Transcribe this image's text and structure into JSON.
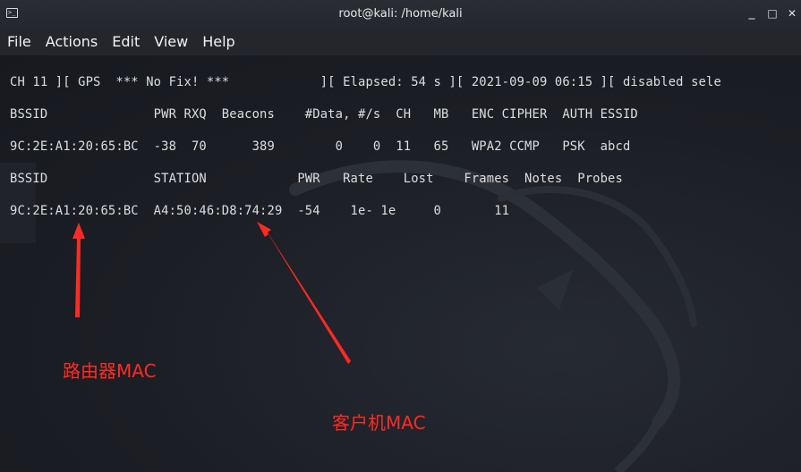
{
  "window": {
    "title": "root@kali: /home/kali",
    "minimize_glyph": "_",
    "maximize_glyph": "□",
    "close_glyph": "✕"
  },
  "menu": [
    "File",
    "Actions",
    "Edit",
    "View",
    "Help"
  ],
  "terminal": {
    "status_line": "CH 11 ][ GPS  *** No Fix! ***            ][ Elapsed: 54 s ][ 2021-09-09 06:15 ][ disabled sele",
    "ap_header": "BSSID              PWR RXQ  Beacons    #Data, #/s  CH   MB   ENC CIPHER  AUTH ESSID",
    "ap_row": "9C:2E:A1:20:65:BC  -38  70      389        0    0  11   65   WPA2 CCMP   PSK  abcd",
    "station_header": "BSSID              STATION            PWR   Rate    Lost    Frames  Notes  Probes",
    "station_row": "9C:2E:A1:20:65:BC  A4:50:46:D8:74:29  -54    1e- 1e     0       11"
  },
  "annotations": {
    "router_label": "路由器MAC",
    "client_label": "客户机MAC",
    "arrow_color": "#ff2b22"
  }
}
